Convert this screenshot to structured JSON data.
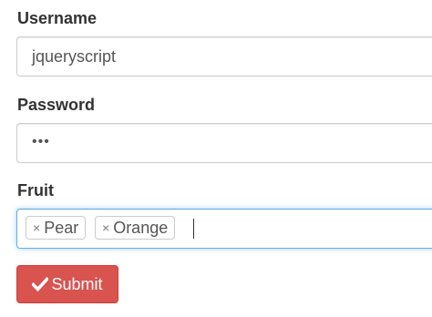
{
  "username": {
    "label": "Username",
    "value": "jqueryscript"
  },
  "password": {
    "label": "Password",
    "masked_value": "•••"
  },
  "fruit": {
    "label": "Fruit",
    "tags": [
      {
        "remove": "×",
        "label": "Pear"
      },
      {
        "remove": "×",
        "label": "Orange"
      }
    ]
  },
  "submit": {
    "label": "Submit",
    "icon": "checkmark-icon",
    "color": "#d9534f"
  },
  "colors": {
    "focus_border": "#66afe9",
    "text": "#333333"
  }
}
